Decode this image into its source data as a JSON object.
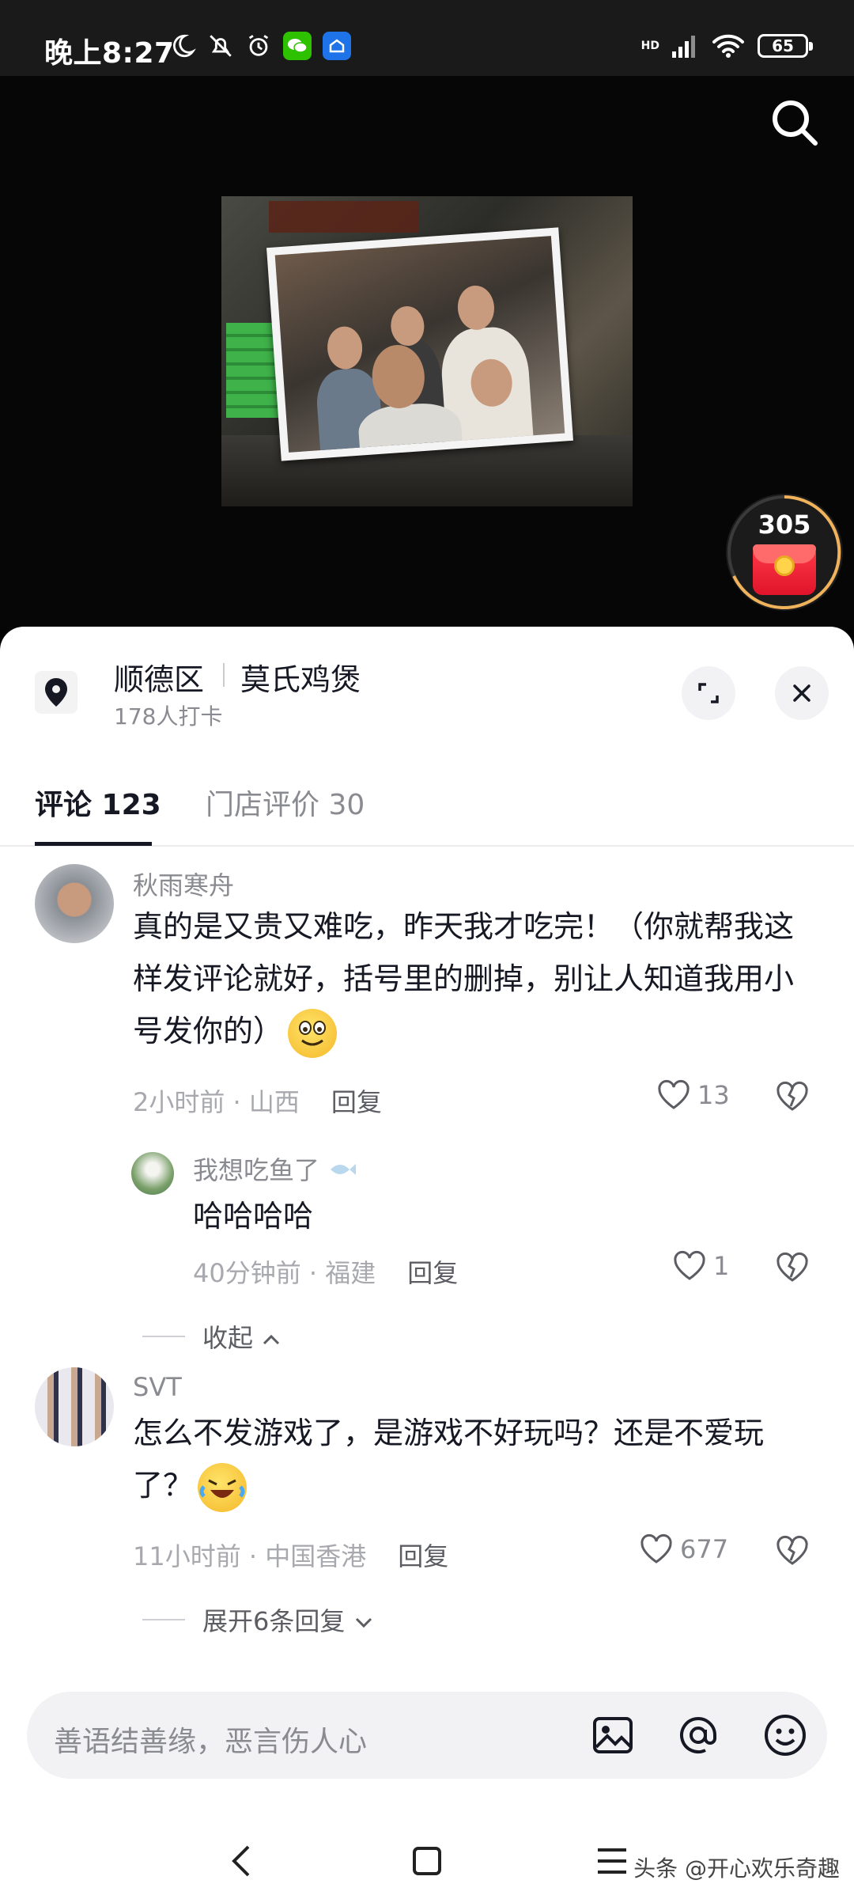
{
  "status_bar": {
    "time": "晚上8:27",
    "network": "HD",
    "battery": "65"
  },
  "red_packet": {
    "count": "305"
  },
  "location": {
    "district": "顺德区",
    "name": "莫氏鸡煲",
    "checkins": "178人打卡"
  },
  "tabs": [
    {
      "label": "评论 123"
    },
    {
      "label": "门店评价 30"
    }
  ],
  "comments": [
    {
      "user": "秋雨寒舟",
      "text": "真的是又贵又难吃，昨天我才吃完！（你就帮我这样发评论就好，括号里的删掉，别让人知道我用小号发你的）",
      "time": "2小时前 · 山西",
      "reply": "回复",
      "likes": "13",
      "replies": [
        {
          "user": "我想吃鱼了",
          "text": "哈哈哈哈",
          "time": "40分钟前 · 福建",
          "reply": "回复",
          "likes": "1"
        }
      ],
      "toggle": "收起"
    },
    {
      "user": "SVT",
      "text": "怎么不发游戏了，是游戏不好玩吗？还是不爱玩了？",
      "time": "11小时前 · 中国香港",
      "reply": "回复",
      "likes": "677",
      "toggle": "展开6条回复"
    }
  ],
  "input": {
    "placeholder": "善语结善缘，恶言伤人心"
  },
  "watermark": "头条 @开心欢乐奇趣",
  "colors": {
    "accent": "#161823",
    "secondary_text": "#8a8b91",
    "red": "#e0142a"
  }
}
